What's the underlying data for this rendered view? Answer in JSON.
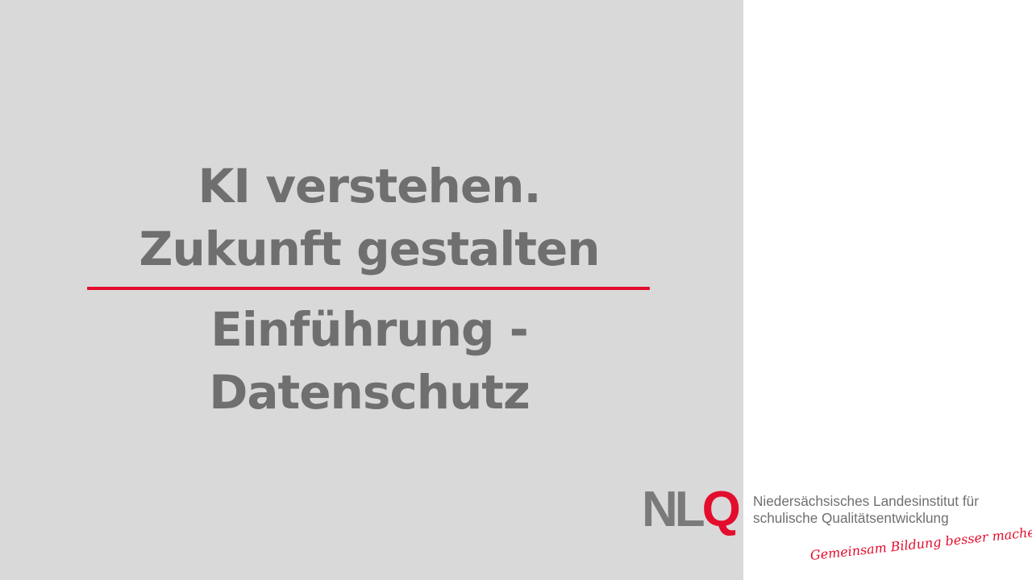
{
  "slide": {
    "title_top": {
      "line1": "KI verstehen.",
      "line2": "Zukunft gestalten"
    },
    "title_bottom": {
      "line1": "Einführung -",
      "line2": "Datenschutz"
    }
  },
  "branding": {
    "logo_text": {
      "part1": "NL",
      "part2": "Q"
    },
    "organization": {
      "line1": "Niedersächsisches Landesinstitut für",
      "line2": "schulische Qualitätsentwicklung"
    },
    "tagline": "Gemeinsam Bildung besser machen!"
  },
  "colors": {
    "left_panel": "#d9d9d9",
    "right_panel": "#ffffff",
    "title_text": "#6f6f6f",
    "accent": "#e30d2d",
    "logo_gray": "#7a7a7a"
  }
}
